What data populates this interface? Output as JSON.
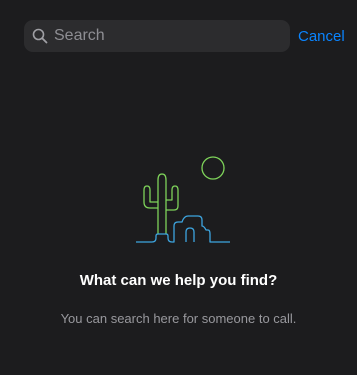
{
  "search": {
    "placeholder": "Search",
    "value": "",
    "cancel_label": "Cancel"
  },
  "empty_state": {
    "illustration": "desert-cactus-icon",
    "title": "What can we help you find?",
    "subtitle": "You can search here for someone to call."
  },
  "colors": {
    "background": "#1c1c1e",
    "search_field": "#2c2c2e",
    "accent": "#0a84ff",
    "sun": "#7ed35a",
    "cactus": "#7ed35a",
    "ground": "#3da5e0"
  }
}
